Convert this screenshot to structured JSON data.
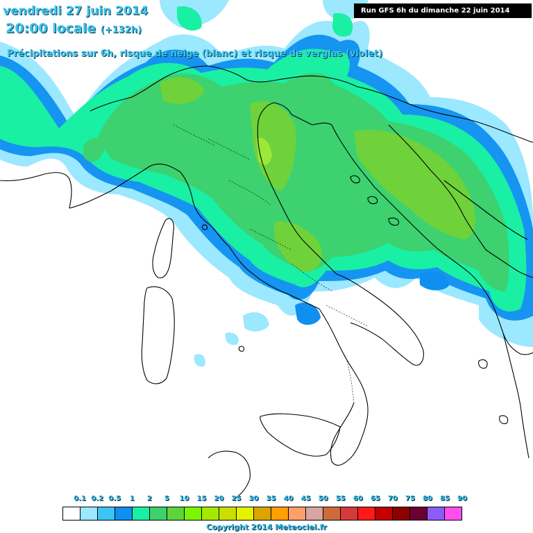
{
  "header": {
    "date_line": "vendredi 27 juin 2014",
    "time_line": "20:00 locale",
    "offset": "(+132h)",
    "subtitle": "Précipitations sur 6h, risque de neige (blanc) et risque de verglas (violet)",
    "run_info": "Run GFS 6h du dimanche 22 juin 2014"
  },
  "legend": {
    "labels": [
      "0.1",
      "0.2",
      "0.5",
      "1",
      "2",
      "5",
      "10",
      "15",
      "20",
      "25",
      "30",
      "35",
      "40",
      "45",
      "50",
      "55",
      "60",
      "65",
      "70",
      "75",
      "80",
      "85",
      "90"
    ],
    "colors": [
      "#ffffff",
      "#9be8ff",
      "#3fc3f5",
      "#0f8ff0",
      "#19f0a3",
      "#3dd170",
      "#5fd43a",
      "#7bf500",
      "#a6e800",
      "#c9e000",
      "#e6f200",
      "#d9a600",
      "#ff9f00",
      "#ff9f6a",
      "#d8a4a4",
      "#cf6a3a",
      "#d43a3a",
      "#ff1a1a",
      "#c40000",
      "#8c0000",
      "#6a0033",
      "#8b5cf6",
      "#ff4df0"
    ]
  },
  "map": {
    "description_colors": {
      "light_blue": "#9be8ff",
      "blue": "#0f8ff0",
      "teal": "#19f0a3",
      "green": "#3dd170",
      "lime": "#6fd23a"
    }
  },
  "footer": {
    "copyright": "Copyright 2014 Meteociel.fr"
  }
}
